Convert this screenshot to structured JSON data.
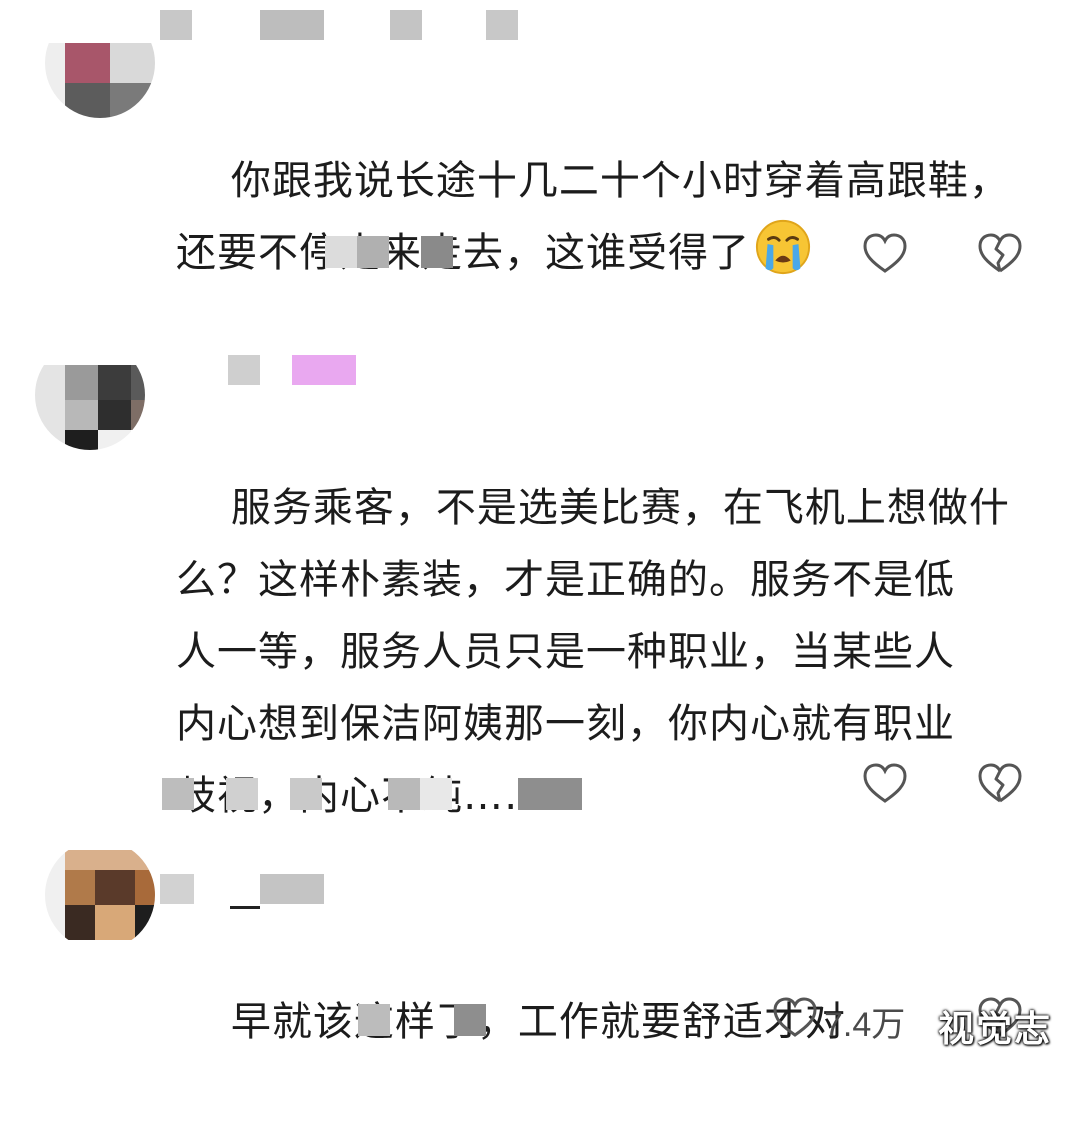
{
  "comments": [
    {
      "text": "你跟我说长途十几二十个小时穿着高跟鞋，\n还要不停走来走去，这谁受得了",
      "emoji": "crying-face"
    },
    {
      "text": "服务乘客，不是选美比赛，在飞机上想做什\n么？这样朴素装，才是正确的。服务不是低\n人一等，服务人员只是一种职业，当某些人\n内心想到保洁阿姨那一刻，你内心就有职业\n歧视，内心不纯……"
    },
    {
      "text": "早就该这样了，工作就要舒适才对",
      "like_count": "7.4万"
    }
  ],
  "watermark": "视觉志",
  "colors": {
    "text": "#1c1c1c",
    "icon_stroke": "#555555",
    "redacted_pink": "#e9a8f0"
  }
}
